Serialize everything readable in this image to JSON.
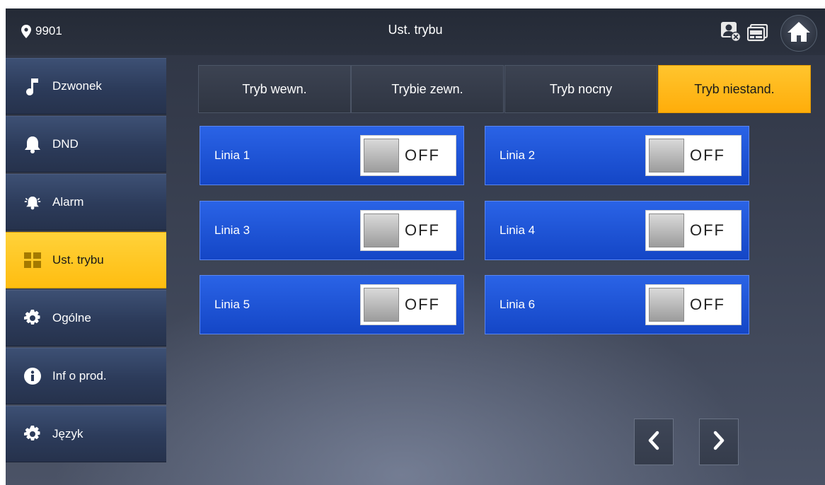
{
  "header": {
    "device_id": "9901",
    "title": "Ust. trybu",
    "icons": [
      "location-pin-icon",
      "contact-status-icon",
      "monitor-icon",
      "home-icon"
    ]
  },
  "sidebar": {
    "items": [
      {
        "label": "Dzwonek",
        "icon": "music-note-icon",
        "active": false
      },
      {
        "label": "DND",
        "icon": "bell-icon",
        "active": false
      },
      {
        "label": "Alarm",
        "icon": "alarm-icon",
        "active": false
      },
      {
        "label": "Ust. trybu",
        "icon": "mode-grid-icon",
        "active": true
      },
      {
        "label": "Ogólne",
        "icon": "gear-icon",
        "active": false
      },
      {
        "label": "Inf o prod.",
        "icon": "info-icon",
        "active": false
      },
      {
        "label": "Język",
        "icon": "gear-icon",
        "active": false
      }
    ]
  },
  "tabs": [
    {
      "label": "Tryb wewn.",
      "active": false
    },
    {
      "label": "Trybie zewn.",
      "active": false
    },
    {
      "label": "Tryb nocny",
      "active": false
    },
    {
      "label": "Tryb niestand.",
      "active": true
    }
  ],
  "lines": [
    {
      "label": "Linia 1",
      "state": "OFF"
    },
    {
      "label": "Linia 2",
      "state": "OFF"
    },
    {
      "label": "Linia 3",
      "state": "OFF"
    },
    {
      "label": "Linia 4",
      "state": "OFF"
    },
    {
      "label": "Linia 5",
      "state": "OFF"
    },
    {
      "label": "Linia 6",
      "state": "OFF"
    }
  ],
  "pager": {
    "prev_icon": "chevron-left-icon",
    "next_icon": "chevron-right-icon"
  },
  "colors": {
    "accent": "#ffbd10",
    "card_blue": "#1d52d6",
    "background": "#3a4152"
  }
}
